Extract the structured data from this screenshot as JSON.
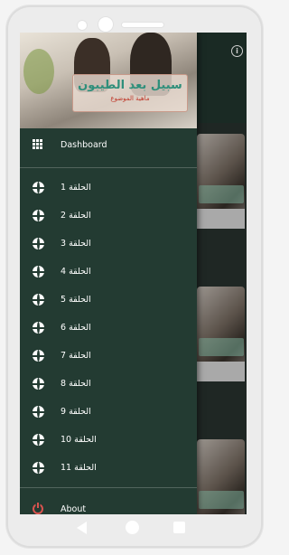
{
  "header": {
    "banner_title": "سبيل بعد الطيبون",
    "banner_subtitle": "ماهية الموضوع"
  },
  "menu": {
    "dashboard_label": "Dashboard",
    "items": [
      {
        "label": "الحلقة 1",
        "icon": "globe-icon"
      },
      {
        "label": "الحلقة 2",
        "icon": "globe-icon"
      },
      {
        "label": "الحلقة 3",
        "icon": "globe-icon"
      },
      {
        "label": "الحلقة 4",
        "icon": "globe-icon"
      },
      {
        "label": "الحلقة 5",
        "icon": "globe-icon"
      },
      {
        "label": "الحلقة 6",
        "icon": "globe-icon"
      },
      {
        "label": "الحلقة 7",
        "icon": "globe-icon"
      },
      {
        "label": "الحلقة 8",
        "icon": "globe-icon"
      },
      {
        "label": "الحلقة 9",
        "icon": "globe-icon"
      },
      {
        "label": "الحلقة 10",
        "icon": "globe-icon"
      },
      {
        "label": "الحلقة 11",
        "icon": "globe-icon"
      }
    ],
    "about_label": "About"
  },
  "icons": {
    "dashboard": "grid-icon",
    "about": "power-icon",
    "info": "info-icon"
  },
  "colors": {
    "drawer_bg": "#233b32",
    "about_icon": "#d9534f",
    "text": "#ffffff"
  }
}
